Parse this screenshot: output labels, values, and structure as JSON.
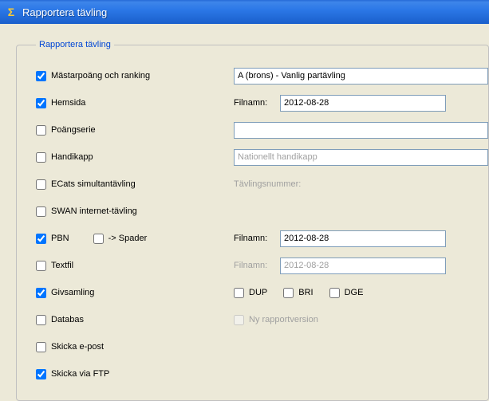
{
  "window": {
    "title": "Rapportera tävling"
  },
  "group": {
    "legend": "Rapportera tävling"
  },
  "rows": {
    "mastar": {
      "label": "Mästarpoäng och ranking",
      "checked": true,
      "select_value": "A (brons) - Vanlig partävling"
    },
    "hemsida": {
      "label": "Hemsida",
      "checked": true,
      "field_label": "Filnamn:",
      "value": "2012-08-28"
    },
    "poangserie": {
      "label": "Poängserie",
      "checked": false,
      "value": ""
    },
    "handikapp": {
      "label": "Handikapp",
      "checked": false,
      "select_value": "Nationellt handikapp"
    },
    "ecats": {
      "label": "ECats simultantävling",
      "checked": false,
      "field_label": "Tävlingsnummer:"
    },
    "swan": {
      "label": "SWAN internet-tävling",
      "checked": false
    },
    "pbn": {
      "label": "PBN",
      "checked": true,
      "spader_label": "-> Spader",
      "spader_checked": false,
      "field_label": "Filnamn:",
      "value": "2012-08-28"
    },
    "textfil": {
      "label": "Textfil",
      "checked": false,
      "field_label": "Filnamn:",
      "value": "2012-08-28"
    },
    "givsamling": {
      "label": "Givsamling",
      "checked": true,
      "dup": {
        "label": "DUP",
        "checked": false
      },
      "bri": {
        "label": "BRI",
        "checked": false
      },
      "dge": {
        "label": "DGE",
        "checked": false
      }
    },
    "databas": {
      "label": "Databas",
      "checked": false,
      "ny_rapport_label": "Ny rapportversion",
      "ny_rapport_checked": false
    },
    "epost": {
      "label": "Skicka e-post",
      "checked": false
    },
    "ftp": {
      "label": "Skicka via FTP",
      "checked": true
    }
  }
}
